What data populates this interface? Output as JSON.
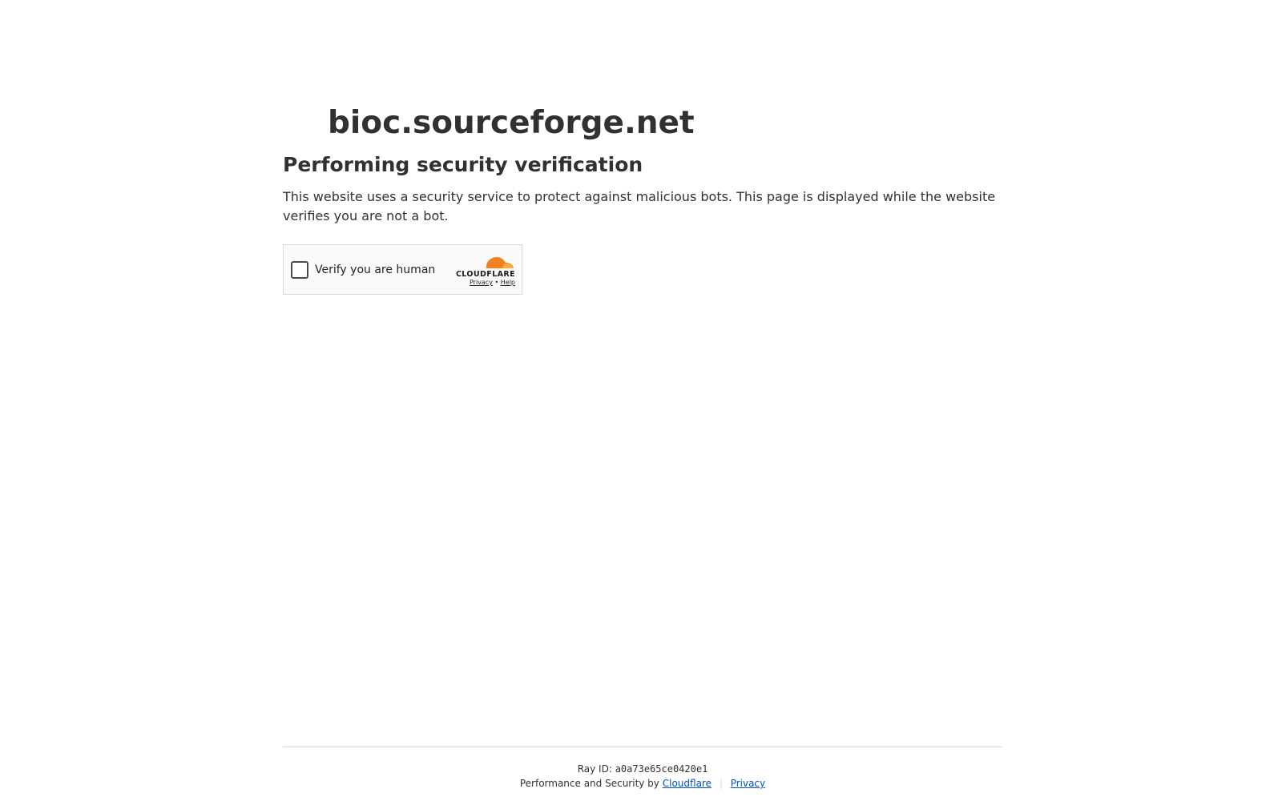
{
  "header": {
    "site_name": "bioc.sourceforge.net",
    "subheading": "Performing security verification",
    "description": "This website uses a security service to protect against malicious bots. This page is displayed while the website verifies you are not a bot."
  },
  "widget": {
    "checkbox_label": "Verify you are human",
    "brand_name": "CLOUDFLARE",
    "privacy_label": "Privacy",
    "separator": "•",
    "help_label": "Help",
    "checkbox_icon": "checkbox-unchecked-icon",
    "logo_icon": "cloudflare-cloud-icon"
  },
  "footer": {
    "ray_label": "Ray ID:",
    "ray_id": "a0a73e65ce0420e1",
    "performance_text": "Performance and Security by",
    "cloudflare_link": "Cloudflare",
    "divider": "|",
    "privacy_link": "Privacy"
  },
  "colors": {
    "text": "#313131",
    "link": "#0051c3",
    "border": "#d9d9d9",
    "widget_bg": "#fafafa",
    "cloud_orange": "#f48120",
    "cloud_light_orange": "#faad3f"
  }
}
